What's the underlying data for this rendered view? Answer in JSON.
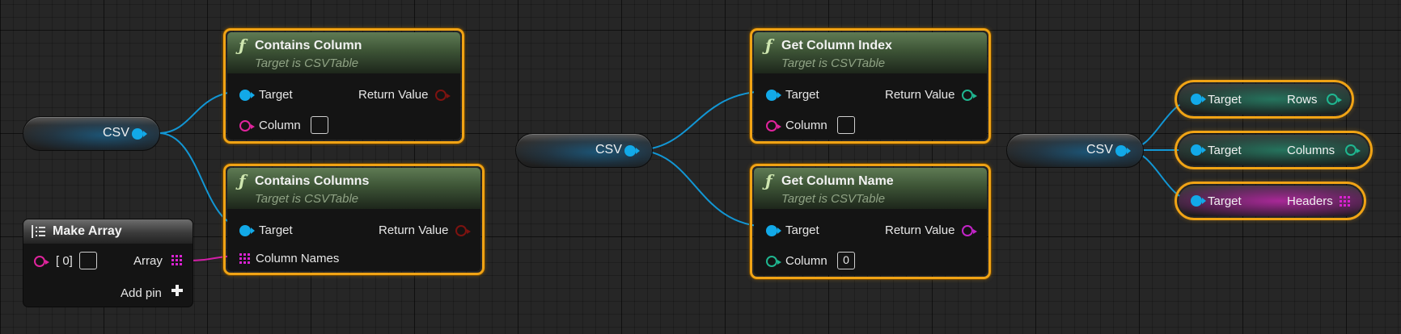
{
  "nodes": {
    "contains_column": {
      "title": "Contains Column",
      "subtitle": "Target is CSVTable",
      "target": "Target",
      "return_value": "Return Value",
      "column": "Column"
    },
    "contains_columns": {
      "title": "Contains Columns",
      "subtitle": "Target is CSVTable",
      "target": "Target",
      "return_value": "Return Value",
      "column_names": "Column Names"
    },
    "get_column_index": {
      "title": "Get Column Index",
      "subtitle": "Target is CSVTable",
      "target": "Target",
      "return_value": "Return Value",
      "column": "Column"
    },
    "get_column_name": {
      "title": "Get Column Name",
      "subtitle": "Target is CSVTable",
      "target": "Target",
      "return_value": "Return Value",
      "column": "Column",
      "column_value": "0"
    },
    "make_array": {
      "title": "Make Array",
      "index_label": "[ 0]",
      "array_label": "Array",
      "add_pin": "Add pin"
    },
    "csv_var_1": {
      "label": "CSV"
    },
    "csv_var_2": {
      "label": "CSV"
    },
    "csv_var_3": {
      "label": "CSV"
    },
    "get_rows": {
      "target": "Target",
      "output": "Rows"
    },
    "get_columns": {
      "target": "Target",
      "output": "Columns"
    },
    "get_headers": {
      "target": "Target",
      "output": "Headers"
    }
  },
  "colors": {
    "object_pin": "#12a9e8",
    "string_pin": "#e0249d",
    "bool_pin": "#7d1310",
    "int_pin": "#1fb690",
    "name_pin": "#c324c8",
    "selection_outline": "#f0a315",
    "function_header": "#4e6745"
  },
  "icons": {
    "function": "function-f-icon",
    "make_array": "make-array-icon",
    "add_pin": "plus-icon",
    "array_pin": "array-grid-icon"
  }
}
